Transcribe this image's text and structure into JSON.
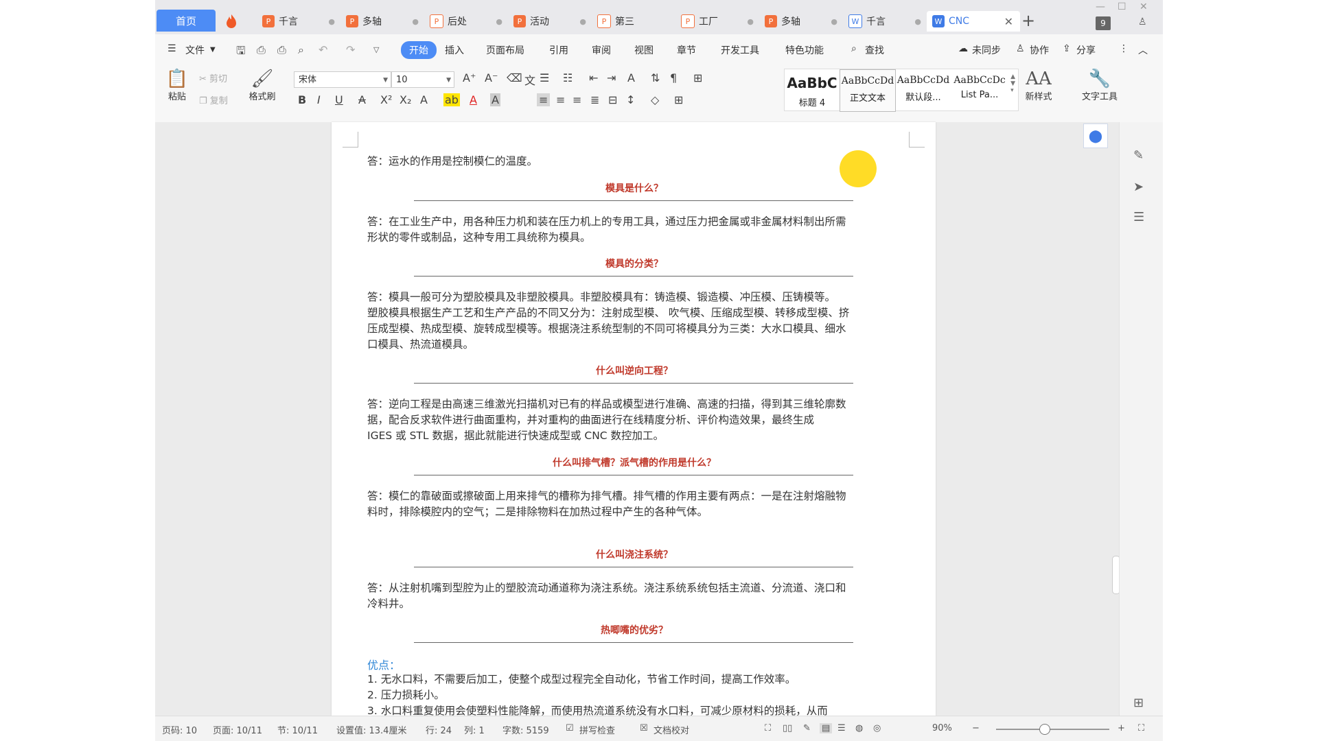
{
  "tabs": {
    "home": "首页",
    "documents": [
      {
        "label": "千言",
        "type": "p"
      },
      {
        "label": "多轴",
        "type": "p"
      },
      {
        "label": "后处",
        "type": "p"
      },
      {
        "label": "活动",
        "type": "p"
      },
      {
        "label": "第三",
        "type": "p"
      },
      {
        "label": "工厂",
        "type": "p"
      },
      {
        "label": "多轴",
        "type": "p"
      },
      {
        "label": "千言",
        "type": "w"
      },
      {
        "label": "CNC",
        "type": "w",
        "active": true
      }
    ],
    "badge": "9"
  },
  "menu": {
    "file": "文件",
    "items": [
      "开始",
      "插入",
      "页面布局",
      "引用",
      "审阅",
      "视图",
      "章节",
      "开发工具",
      "特色功能"
    ],
    "active": "开始",
    "search": "查找",
    "sync": "未同步",
    "collab": "协作",
    "share": "分享"
  },
  "ribbon": {
    "paste": "粘贴",
    "cut": "剪切",
    "copy": "复制",
    "format_painter": "格式刷",
    "font": "宋体",
    "size": "10",
    "styles": [
      {
        "sample": "AaBbC",
        "name": "标题 4"
      },
      {
        "sample": "AaBbCcDd",
        "name": "正文文本"
      },
      {
        "sample": "AaBbCcDd",
        "name": "默认段..."
      },
      {
        "sample": "AaBbCcDc",
        "name": "List Pa..."
      }
    ],
    "new_style": "新样式",
    "text_tools": "文字工具"
  },
  "document": {
    "a0": "答：运水的作用是控制模仁的温度。",
    "q1": "模具是什么？",
    "a1_l1": "答：在工业生产中，用各种压力机和装在压力机上的专用工具，通过压力把金属或非金属材料制出所需",
    "a1_l2": "形状的零件或制品，这种专用工具统称为模具。",
    "q2": "模具的分类？",
    "a2_l1": "答：模具一般可分为塑胶模具及非塑胶模具。非塑胶模具有：铸造模、锻造模、冲压模、压铸模等。",
    "a2_l2": "塑胶模具根据生产工艺和生产产品的不同又分为：注射成型模、 吹气模、压缩成型模、转移成型模、挤",
    "a2_l3": "压成型模、热成型模、旋转成型模等。根据浇注系统型制的不同可将模具分为三类：大水口模具、细水",
    "a2_l4": "口模具、热流道模具。",
    "q3": "什么叫逆向工程？",
    "a3_l1": "答：逆向工程是由高速三维激光扫描机对已有的样品或模型进行准确、高速的扫描，得到其三维轮廓数",
    "a3_l2": "据，配合反求软件进行曲面重构，并对重构的曲面进行在线精度分析、评价构造效果，最终生成",
    "a3_l3": "IGES 或 STL 数据，据此就能进行快速成型或 CNC 数控加工。",
    "q4": "什么叫排气槽？派气槽的作用是什么？",
    "a4_l1": "答：模仁的靠破面或擦破面上用来排气的槽称为排气槽。排气槽的作用主要有两点：一是在注射熔融物",
    "a4_l2": "料时，排除模腔内的空气；二是排除物料在加热过程中产生的各种气体。",
    "q5": "什么叫浇注系统？",
    "a5_l1": "答：从注射机嘴到型腔为止的塑胶流动通道称为浇注系统。浇注系统系统包括主流道、分流道、浇口和",
    "a5_l2": "冷料井。",
    "q6": "热唧嘴的优劣？",
    "advantages": "优点：",
    "li1": "1. 无水口料，不需要后加工，使整个成型过程完全自动化，节省工作时间，提高工作效率。",
    "li2": "2. 压力损耗小。",
    "li3": "3. 水口料重复使用会使塑料性能降解，而使用热流道系统没有水口料，可减少原材料的损耗，从而"
  },
  "status": {
    "page_code": "页码: 10",
    "page": "页面: 10/11",
    "section": "节: 10/11",
    "setting": "设置值: 13.4厘米",
    "row": "行: 24",
    "col": "列: 1",
    "words": "字数: 5159",
    "spell": "拼写检查",
    "proof": "文档校对",
    "zoom": "90%"
  }
}
